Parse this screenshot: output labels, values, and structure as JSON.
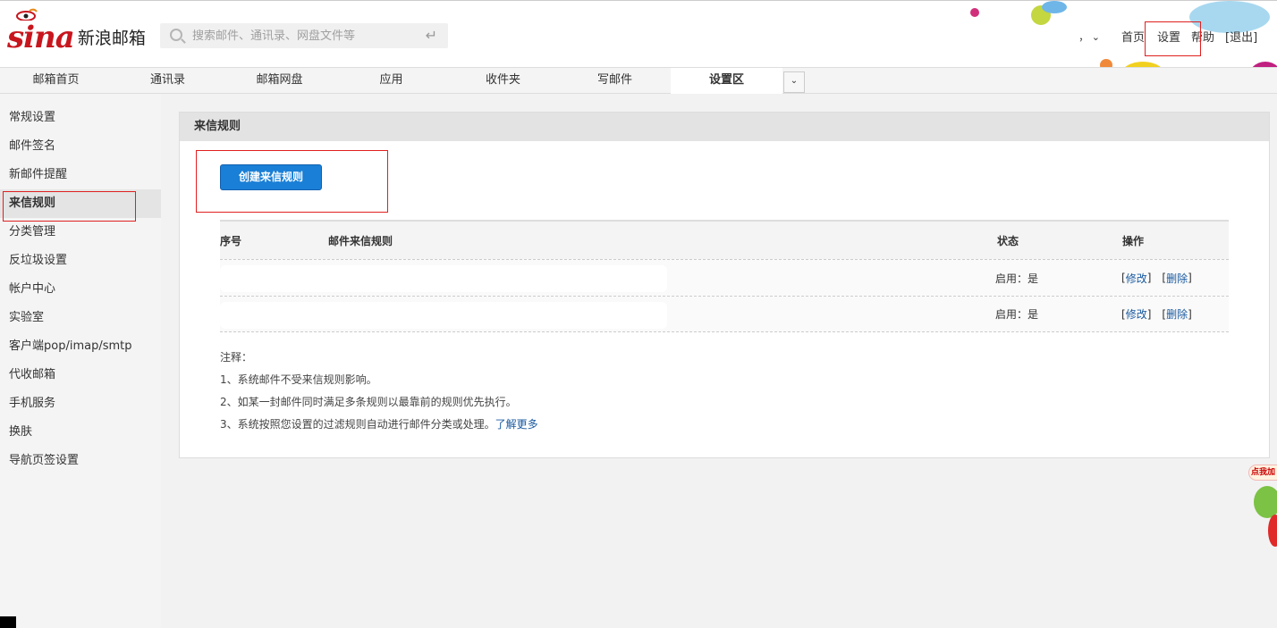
{
  "header": {
    "logo_brand": "sina",
    "logo_product": "新浪邮箱",
    "search_placeholder": "搜索邮件、通讯录、网盘文件等",
    "user_dropdown": "，",
    "links": [
      "首页",
      "设置",
      "帮助",
      "[退出]"
    ]
  },
  "nav": {
    "tabs": [
      "邮箱首页",
      "通讯录",
      "邮箱网盘",
      "应用",
      "收件夹",
      "写邮件",
      "设置区"
    ],
    "active_index": 6
  },
  "sidebar": {
    "items": [
      "常规设置",
      "邮件签名",
      "新邮件提醒",
      "来信规则",
      "分类管理",
      "反垃圾设置",
      "帐户中心",
      "实验室",
      "客户端pop/imap/smtp",
      "代收邮箱",
      "手机服务",
      "换肤",
      "导航页签设置"
    ],
    "active_index": 3
  },
  "panel": {
    "title": "来信规则",
    "create_button": "创建来信规则"
  },
  "table": {
    "headers": [
      "序号",
      "邮件来信规则",
      "状态",
      "操作"
    ],
    "rows": [
      {
        "status": "启用：是",
        "edit": "修改",
        "delete": "删除"
      },
      {
        "status": "启用：是",
        "edit": "修改",
        "delete": "删除"
      }
    ]
  },
  "notes": {
    "title": "注释：",
    "lines": [
      "1、系统邮件不受来信规则影响。",
      "2、如某一封邮件同时满足多条规则以最靠前的规则优先执行。",
      "3、系统按照您设置的过滤规则自动进行邮件分类或处理。"
    ],
    "more_link": "了解更多"
  },
  "widget_text": "点我加",
  "colors": {
    "brand_red": "#c8161e",
    "button_blue": "#1a7fd6",
    "link_blue": "#1a5aa0",
    "highlight_red": "#e02020"
  }
}
